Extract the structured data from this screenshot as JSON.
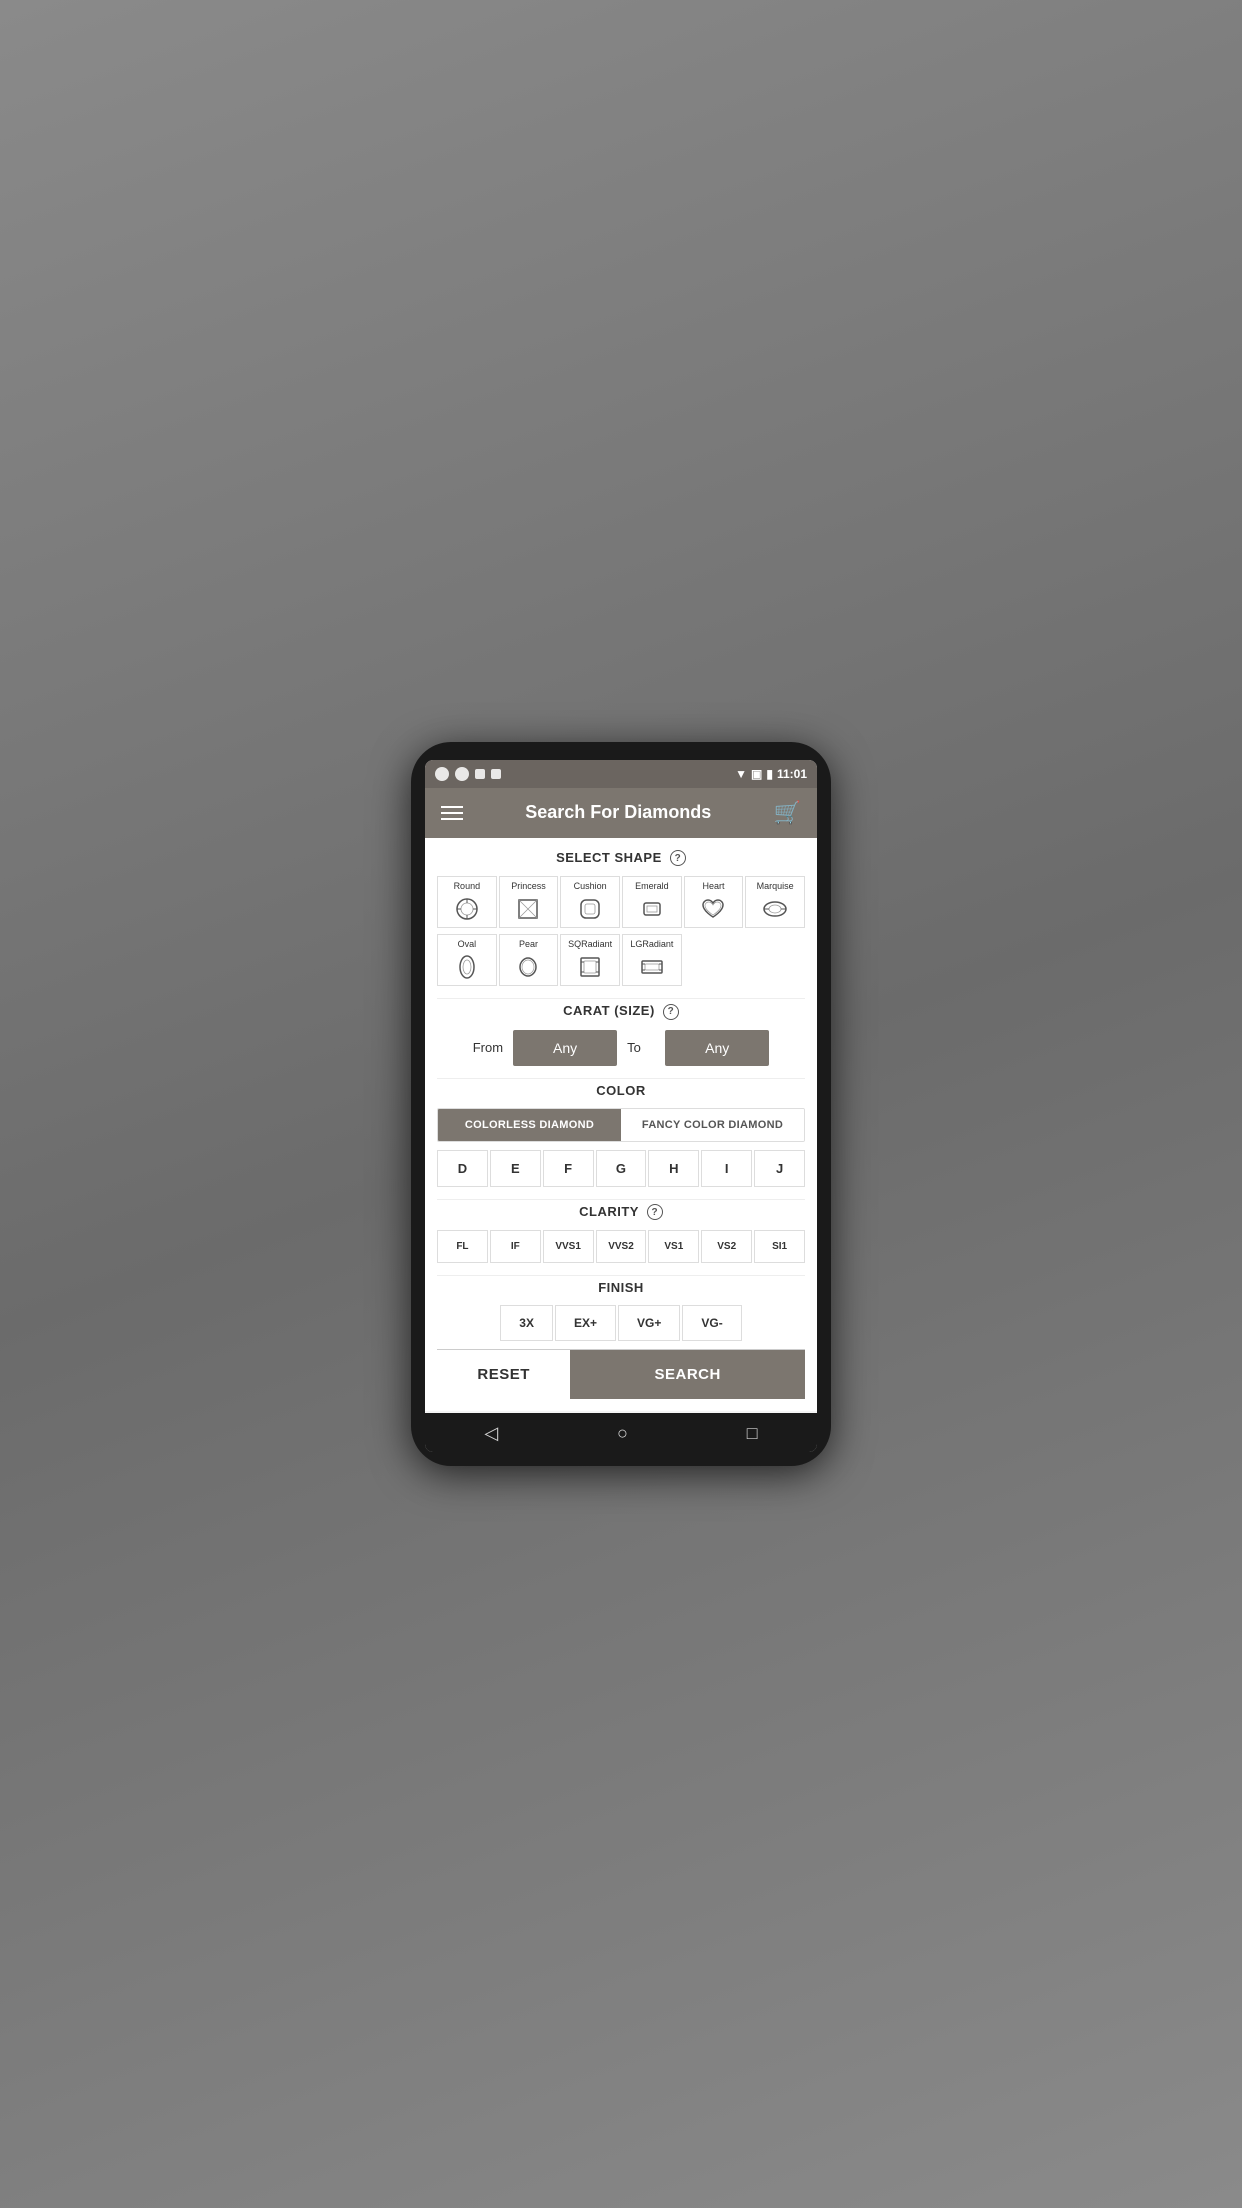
{
  "app": {
    "title": "Search For Diamonds",
    "status_time": "11:01"
  },
  "sections": {
    "shape": {
      "title": "SELECT SHAPE",
      "shapes_row1": [
        {
          "label": "Round",
          "symbol": "⬡"
        },
        {
          "label": "Princess",
          "symbol": "◼"
        },
        {
          "label": "Cushion",
          "symbol": "⬢"
        },
        {
          "label": "Emerald",
          "symbol": "▬"
        },
        {
          "label": "Heart",
          "symbol": "♥"
        },
        {
          "label": "Marquise",
          "symbol": "◈"
        }
      ],
      "shapes_row2": [
        {
          "label": "Oval",
          "symbol": "⬭"
        },
        {
          "label": "Pear",
          "symbol": "🍐"
        },
        {
          "label": "SQRadiant",
          "symbol": "◻"
        },
        {
          "label": "LGRadiant",
          "symbol": "▭"
        },
        {
          "label": "",
          "symbol": ""
        },
        {
          "label": "",
          "symbol": ""
        }
      ]
    },
    "carat": {
      "title": "CARAT (SIZE)",
      "from_label": "From",
      "to_label": "To",
      "from_value": "Any",
      "to_value": "Any"
    },
    "color": {
      "title": "COLOR",
      "tab_colorless": "COLORLESS DIAMOND",
      "tab_fancy": "FANCY COLOR DIAMOND",
      "active_tab": "colorless",
      "grades": [
        "D",
        "E",
        "F",
        "G",
        "H",
        "I",
        "J"
      ]
    },
    "clarity": {
      "title": "CLARITY",
      "grades": [
        "FL",
        "IF",
        "VVS1",
        "VVS2",
        "VS1",
        "VS2",
        "SI1"
      ]
    },
    "finish": {
      "title": "FINISH",
      "options": [
        "3X",
        "EX+",
        "VG+",
        "VG-"
      ]
    }
  },
  "buttons": {
    "reset": "RESET",
    "search": "SEARCH"
  },
  "nav": {
    "back": "◁",
    "home": "○",
    "recent": "□"
  }
}
